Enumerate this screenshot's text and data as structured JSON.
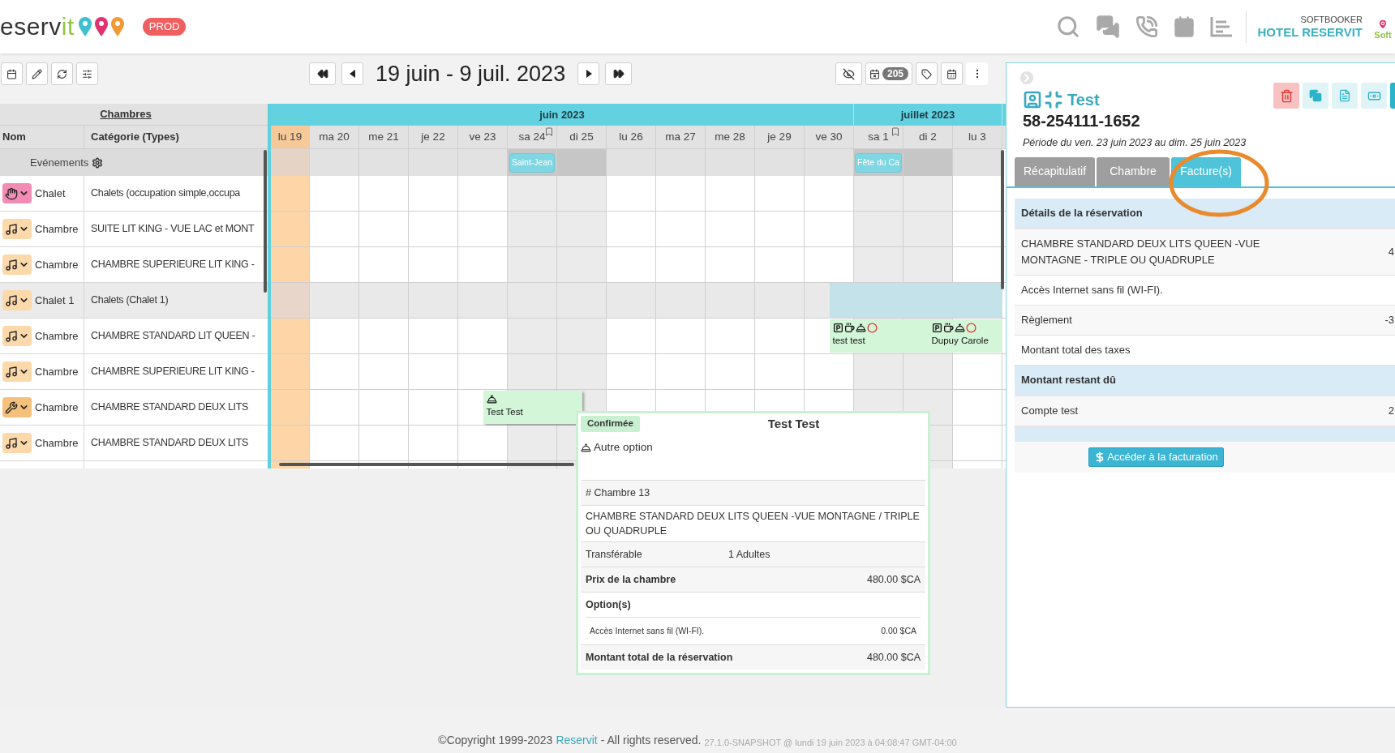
{
  "header": {
    "logo": {
      "main": "eserv",
      "accent": "it"
    },
    "env_badge": "PROD",
    "account": {
      "company": "SOFTBOOKER",
      "hotel": "HOTEL RESERVIT",
      "brand": "Soft"
    }
  },
  "toolbar": {
    "date_range": "19 juin - 9 juil. 2023",
    "pending_count": "205"
  },
  "rooms_table": {
    "group_title": "Chambres",
    "columns": [
      "Nom",
      "Catégorie (Types)"
    ],
    "events_label": "Evénements",
    "rows": [
      {
        "kind": "hand",
        "name": "Chalet",
        "category": "Chalets (occupation simple,occupa",
        "selected": false
      },
      {
        "kind": "note",
        "name": "Chambre",
        "category": "SUITE LIT KING - VUE LAC et MONT",
        "selected": false
      },
      {
        "kind": "note",
        "name": "Chambre",
        "category": "CHAMBRE SUPERIEURE LIT KING -",
        "selected": false
      },
      {
        "kind": "note",
        "name": "Chalet 1",
        "category": "Chalets (Chalet 1)",
        "selected": true,
        "bookings": [
          {
            "kind": "block"
          }
        ]
      },
      {
        "kind": "note",
        "name": "Chambre",
        "category": "CHAMBRE STANDARD LIT QUEEN -",
        "selected": false,
        "bookings": [
          {
            "kind": "booking",
            "guest": "test test",
            "parking": true,
            "breakfast": true,
            "option": true,
            "alert": true
          },
          {
            "kind": "booking",
            "guest": "Dupuy Carole",
            "parking": true,
            "breakfast": true,
            "option": true,
            "alert": true
          }
        ]
      },
      {
        "kind": "note",
        "name": "Chambre",
        "category": "CHAMBRE SUPERIEURE LIT KING -",
        "selected": false
      },
      {
        "kind": "tools",
        "name": "Chambre",
        "category": "CHAMBRE STANDARD DEUX LITS",
        "selected": false,
        "bookings": [
          {
            "kind": "booking",
            "guest": "Test Test",
            "parking": false,
            "breakfast": false,
            "option": true,
            "alert": false
          }
        ]
      },
      {
        "kind": "note",
        "name": "Chambre",
        "category": "CHAMBRE STANDARD DEUX LITS",
        "selected": false
      }
    ]
  },
  "calendar": {
    "months": [
      {
        "label": "juin 2023",
        "days": [
          {
            "label": "lu 19",
            "today": true,
            "weekend": false,
            "bookmark": false
          },
          {
            "label": "ma 20",
            "today": false,
            "weekend": false,
            "bookmark": false
          },
          {
            "label": "me 21",
            "today": false,
            "weekend": false,
            "bookmark": false
          },
          {
            "label": "je 22",
            "today": false,
            "weekend": false,
            "bookmark": false
          },
          {
            "label": "ve 23",
            "today": false,
            "weekend": false,
            "bookmark": false
          },
          {
            "label": "sa 24",
            "today": false,
            "weekend": true,
            "bookmark": true,
            "event": "Saint-Jean"
          },
          {
            "label": "di 25",
            "today": false,
            "weekend": true,
            "bookmark": false
          },
          {
            "label": "lu 26",
            "today": false,
            "weekend": false,
            "bookmark": false
          },
          {
            "label": "ma 27",
            "today": false,
            "weekend": false,
            "bookmark": false
          },
          {
            "label": "me 28",
            "today": false,
            "weekend": false,
            "bookmark": false
          },
          {
            "label": "je 29",
            "today": false,
            "weekend": false,
            "bookmark": false
          },
          {
            "label": "ve 30",
            "today": false,
            "weekend": false,
            "bookmark": false
          }
        ]
      },
      {
        "label": "juillet 2023",
        "days": [
          {
            "label": "sa 1",
            "today": false,
            "weekend": true,
            "bookmark": true,
            "event": "Fête du Ca"
          },
          {
            "label": "di 2",
            "today": false,
            "weekend": true,
            "bookmark": false
          },
          {
            "label": "lu 3",
            "today": false,
            "weekend": false,
            "bookmark": false
          }
        ]
      }
    ]
  },
  "tooltip": {
    "status": "Confirmée",
    "title": "Test Test",
    "option": "Autre option",
    "room": "# Chambre 13",
    "description": "CHAMBRE STANDARD DEUX LITS QUEEN -VUE MONTAGNE / TRIPLE OU QUADRUPLE",
    "transfer": "Transférable",
    "guests": "1 Adultes",
    "price_label": "Prix de la chambre",
    "price": "480.00 $CA",
    "options_label": "Option(s)",
    "option_line": "Accès Internet sans fil (WI-FI).",
    "option_price": "0.00 $CA",
    "total_label": "Montant total de la réservation",
    "total": "480.00 $CA"
  },
  "reservation": {
    "name": "Test",
    "number": "58-254111-1652",
    "period": "Période du ven. 23 juin 2023 au dim. 25 juin 2023",
    "actions": [
      {
        "kind": "delete"
      },
      {
        "kind": "copy"
      },
      {
        "kind": "document"
      },
      {
        "kind": "invoice"
      }
    ],
    "tabs": [
      {
        "label": "Récapitulatif",
        "selected": false
      },
      {
        "label": "Chambre",
        "selected": false
      },
      {
        "label": "Facture(s)",
        "selected": true
      }
    ],
    "invoice_rows": [
      {
        "kind": "section",
        "label": "Détails de la réservation"
      },
      {
        "kind": "item",
        "label": "CHAMBRE STANDARD DEUX LITS QUEEN -VUE MONTAGNE - TRIPLE OU QUADRUPLE",
        "value": "4"
      },
      {
        "kind": "item",
        "label": "Accès Internet sans fil (WI-FI)."
      },
      {
        "kind": "item",
        "label": "Règlement",
        "value": "-3"
      },
      {
        "kind": "item",
        "label": "Montant total des taxes"
      },
      {
        "kind": "section",
        "label": "Montant restant dû"
      },
      {
        "kind": "item",
        "label": "Compte test",
        "value": "2"
      },
      {
        "kind": "spacer"
      }
    ],
    "billing_button": "Accéder à la facturation"
  },
  "footer": {
    "copyright": "©Copyright 1999-2023",
    "link": "Reservit",
    "rights": "- All rights reserved.",
    "version": "27.1.0-SNAPSHOT @ lundi 19 juin 2023 à 04:08:47 GMT-04:00"
  }
}
